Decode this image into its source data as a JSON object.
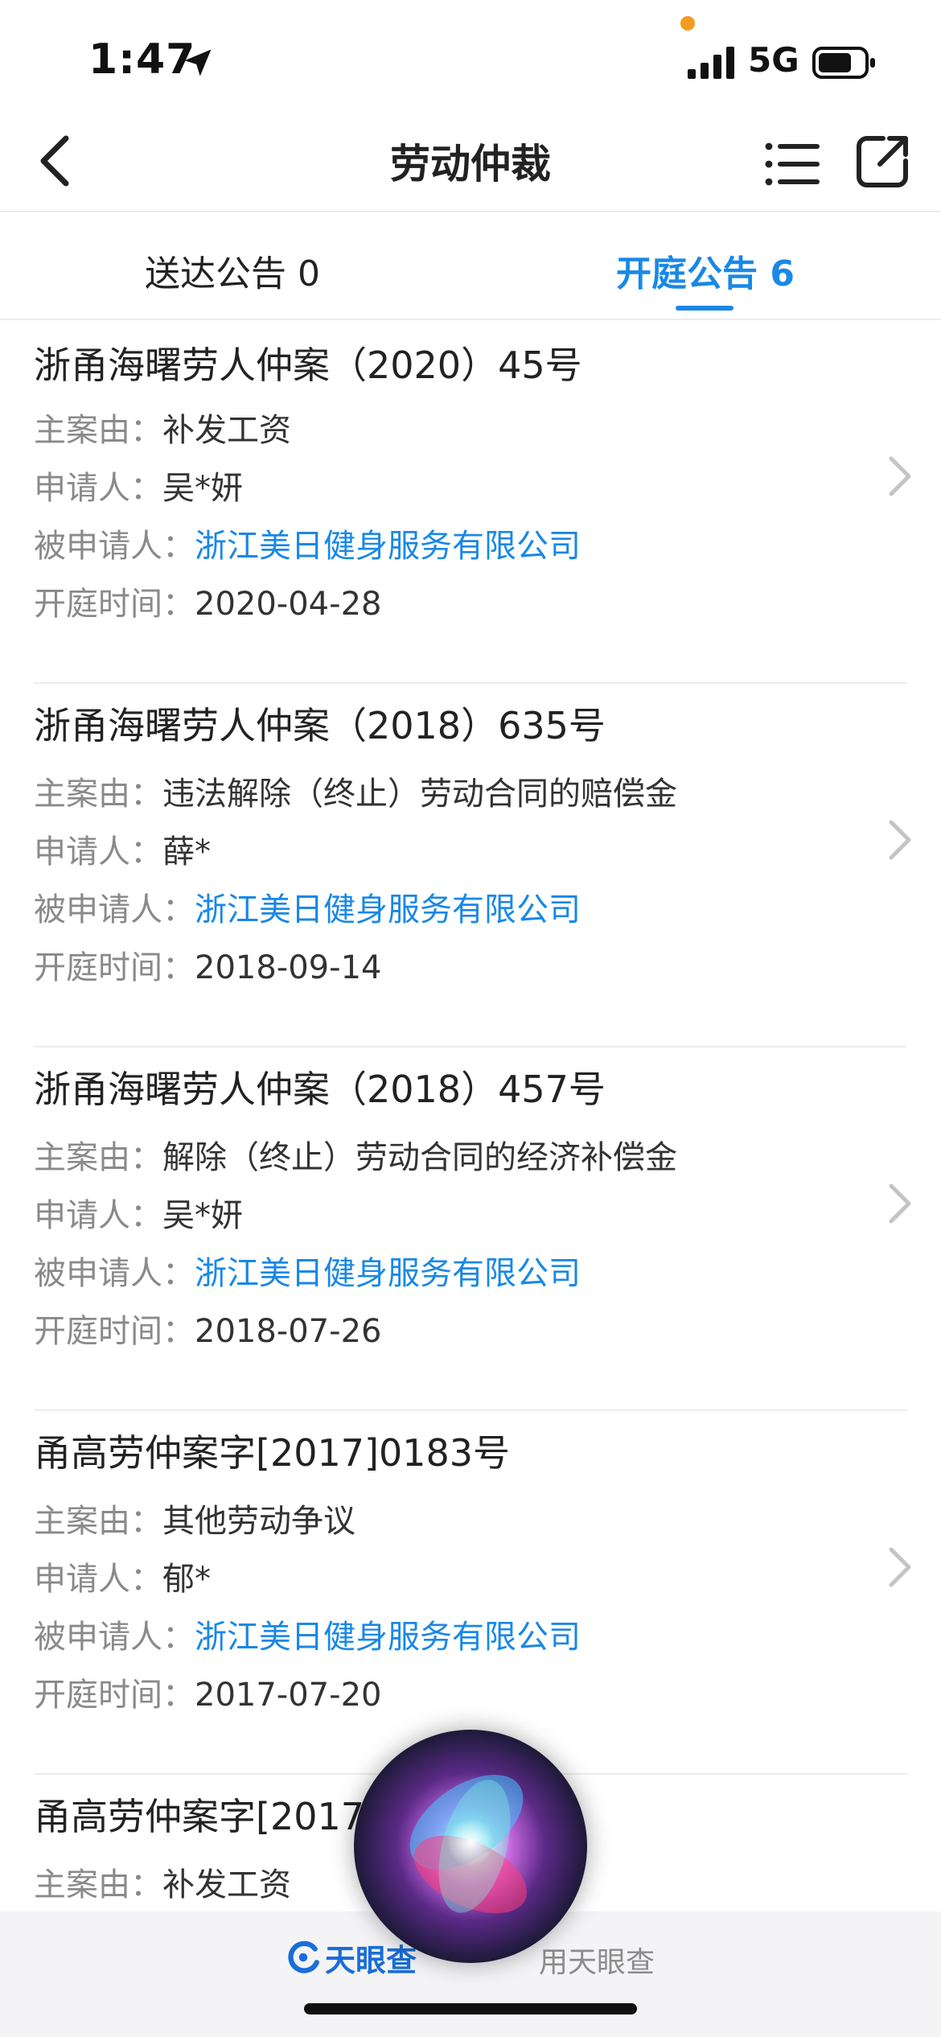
{
  "status_bar": {
    "time": "1:47",
    "network": "5G",
    "indicator_color": "#f39c1f"
  },
  "nav": {
    "title": "劳动仲裁",
    "icons": [
      "chevron-left-icon",
      "list-icon",
      "share-icon"
    ]
  },
  "tabs": [
    {
      "label": "送达公告 0",
      "active": false
    },
    {
      "label": "开庭公告 6",
      "active": true
    }
  ],
  "labels": {
    "cause": "主案由：",
    "applicant": "申请人：",
    "respondent": "被申请人：",
    "hearing_date": "开庭时间："
  },
  "cases": [
    {
      "title": "浙甬海曙劳人仲案（2020）45号",
      "cause": "补发工资",
      "applicant": "吴*妍",
      "respondent": "浙江美日健身服务有限公司",
      "hearing_date": "2020-04-28"
    },
    {
      "title": "浙甬海曙劳人仲案（2018）635号",
      "cause": "违法解除（终止）劳动合同的赔偿金",
      "applicant": "薛*",
      "respondent": "浙江美日健身服务有限公司",
      "hearing_date": "2018-09-14"
    },
    {
      "title": "浙甬海曙劳人仲案（2018）457号",
      "cause": "解除（终止）劳动合同的经济补偿金",
      "applicant": "吴*妍",
      "respondent": "浙江美日健身服务有限公司",
      "hearing_date": "2018-07-26"
    },
    {
      "title": "甬高劳仲案字[2017]0183号",
      "cause": "其他劳动争议",
      "applicant": "郁*",
      "respondent": "浙江美日健身服务有限公司",
      "hearing_date": "2017-07-20"
    },
    {
      "title": "甬高劳仲案字[2017",
      "cause": "补发工资"
    }
  ],
  "footer": {
    "brand": "天眼查",
    "suffix": "用天眼查"
  },
  "colors": {
    "accent": "#1a88e6",
    "label_gray": "#8a8a8a"
  }
}
